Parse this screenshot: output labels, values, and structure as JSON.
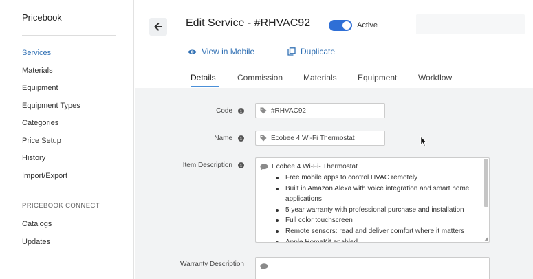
{
  "sidebar": {
    "title": "Pricebook",
    "items": [
      {
        "label": "Services",
        "active": true
      },
      {
        "label": "Materials"
      },
      {
        "label": "Equipment"
      },
      {
        "label": "Equipment Types"
      },
      {
        "label": "Categories"
      },
      {
        "label": "Price Setup"
      },
      {
        "label": "History"
      },
      {
        "label": "Import/Export"
      }
    ],
    "section_title": "PRICEBOOK CONNECT",
    "section_items": [
      {
        "label": "Catalogs"
      },
      {
        "label": "Updates"
      }
    ]
  },
  "header": {
    "title": "Edit Service - #RHVAC92",
    "active_label": "Active",
    "active_on": true,
    "view_mobile_label": "View in Mobile",
    "duplicate_label": "Duplicate"
  },
  "tabs": [
    {
      "label": "Details",
      "active": true
    },
    {
      "label": "Commission"
    },
    {
      "label": "Materials"
    },
    {
      "label": "Equipment"
    },
    {
      "label": "Workflow"
    }
  ],
  "form": {
    "code_label": "Code",
    "code_value": "#RHVAC92",
    "name_label": "Name",
    "name_value": "Ecobee 4 Wi-Fi Thermostat",
    "description_label": "Item Description",
    "description_first_line": "Ecobee 4 Wi-Fi- Thermostat",
    "description_bullets": [
      "Free mobile apps to control HVAC remotely",
      "Built in Amazon Alexa with voice integration and smart home applications",
      "5 year warranty with professional purchase and installation",
      "Full color touchscreen",
      "Remote sensors: read and deliver comfort where it matters",
      "Apple HomeKit enabled"
    ],
    "warranty_label": "Warranty Description"
  },
  "colors": {
    "accent": "#2f6fb3",
    "toggle_on": "#2f6fd6",
    "tab_underline": "#4a8fd8",
    "content_bg": "#f2f3f4"
  }
}
